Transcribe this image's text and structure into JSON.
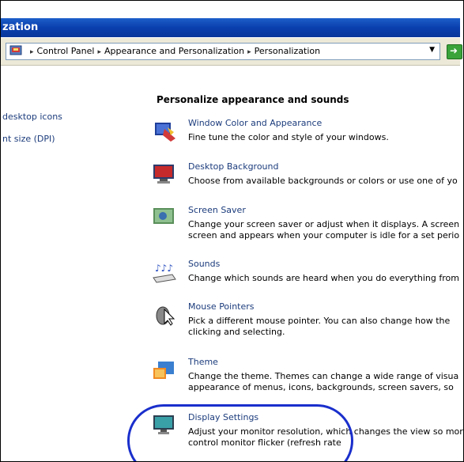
{
  "window": {
    "title": "zation"
  },
  "address": {
    "crumbs": [
      "Control Panel",
      "Appearance and Personalization",
      "Personalization"
    ]
  },
  "sidebar": {
    "links": [
      "desktop icons",
      "nt size (DPI)"
    ]
  },
  "main": {
    "heading": "Personalize appearance and sounds",
    "tasks": [
      {
        "title": "Window Color and Appearance",
        "desc": "Fine tune the color and style of your windows.",
        "icon": "window-color-icon"
      },
      {
        "title": "Desktop Background",
        "desc": "Choose from available backgrounds or colors or use one of yo",
        "icon": "desktop-background-icon"
      },
      {
        "title": "Screen Saver",
        "desc": "Change your screen saver or adjust when it displays. A screen\nscreen and appears when your computer is idle for a set perio",
        "icon": "screen-saver-icon"
      },
      {
        "title": "Sounds",
        "desc": "Change which sounds are heard when you do everything from",
        "icon": "sounds-icon"
      },
      {
        "title": "Mouse Pointers",
        "desc": "Pick a different mouse pointer. You can also change how the\nclicking and selecting.",
        "icon": "mouse-pointer-icon"
      },
      {
        "title": "Theme",
        "desc": "Change the theme. Themes can change a wide range of visua\nappearance of menus, icons, backgrounds, screen savers, so",
        "icon": "theme-icon"
      },
      {
        "title": "Display Settings",
        "desc": "Adjust your monitor resolution, which changes the view so mor\ncontrol monitor flicker (refresh rate",
        "icon": "display-settings-icon"
      }
    ]
  },
  "colors": {
    "titlebar": "#0a3fae",
    "link": "#1c3c7c",
    "highlight_ring": "#1a2fcc"
  }
}
